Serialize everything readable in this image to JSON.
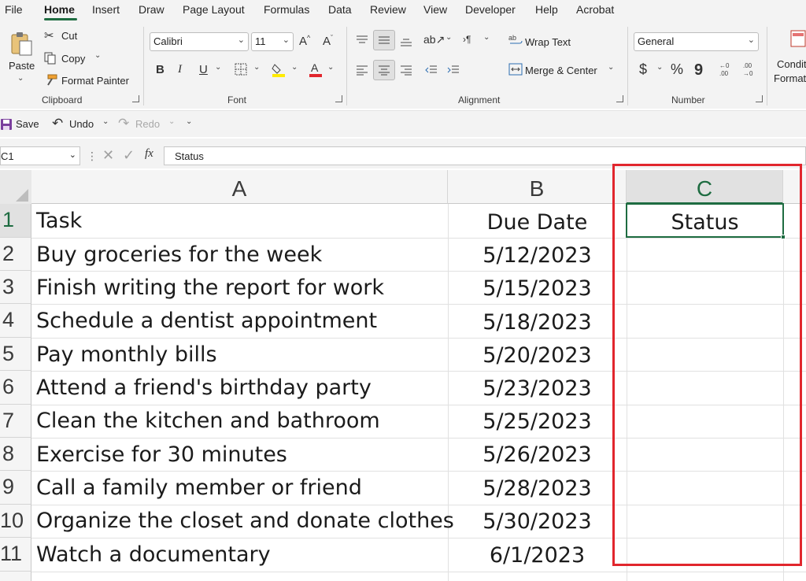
{
  "menu": [
    "File",
    "Home",
    "Insert",
    "Draw",
    "Page Layout",
    "Formulas",
    "Data",
    "Review",
    "View",
    "Developer",
    "Help",
    "Acrobat"
  ],
  "ribbon": {
    "clipboard": {
      "paste": "Paste",
      "cut": "Cut",
      "copy": "Copy",
      "format_painter": "Format Painter",
      "label": "Clipboard"
    },
    "font": {
      "name": "Calibri",
      "size": "11",
      "bold": "B",
      "italic": "I",
      "underline": "U",
      "label": "Font"
    },
    "alignment": {
      "wrap_text": "Wrap Text",
      "merge_center": "Merge & Center",
      "label": "Alignment"
    },
    "number": {
      "format": "General",
      "currency": "$",
      "percent": "%",
      "comma": "9",
      "label": "Number"
    },
    "styles": {
      "conditional_line1": "Conditi",
      "conditional_line2": "Formatt"
    }
  },
  "qat": {
    "save": "Save",
    "undo": "Undo",
    "redo": "Redo"
  },
  "formula_bar": {
    "name_box": "C1",
    "fx": "fx",
    "content": "Status"
  },
  "sheet": {
    "columns": [
      "A",
      "B",
      "C"
    ],
    "rows": [
      {
        "num": "1",
        "task": "Task",
        "date": "Due Date",
        "status": "Status"
      },
      {
        "num": "2",
        "task": "Buy groceries for the week",
        "date": "5/12/2023",
        "status": ""
      },
      {
        "num": "3",
        "task": "Finish writing the report for work",
        "date": "5/15/2023",
        "status": ""
      },
      {
        "num": "4",
        "task": "Schedule a dentist appointment",
        "date": "5/18/2023",
        "status": ""
      },
      {
        "num": "5",
        "task": "Pay monthly bills",
        "date": "5/20/2023",
        "status": ""
      },
      {
        "num": "6",
        "task": "Attend a friend's birthday party",
        "date": "5/23/2023",
        "status": ""
      },
      {
        "num": "7",
        "task": "Clean the kitchen and bathroom",
        "date": "5/25/2023",
        "status": ""
      },
      {
        "num": "8",
        "task": "Exercise for 30 minutes",
        "date": "5/26/2023",
        "status": ""
      },
      {
        "num": "9",
        "task": "Call a family member or friend",
        "date": "5/28/2023",
        "status": ""
      },
      {
        "num": "10",
        "task": "Organize the closet and donate clothes",
        "date": "5/30/2023",
        "status": ""
      },
      {
        "num": "11",
        "task": "Watch a documentary",
        "date": "6/1/2023",
        "status": ""
      }
    ]
  },
  "colors": {
    "accent_green": "#1e6c41",
    "highlight_red": "#e1262d"
  }
}
